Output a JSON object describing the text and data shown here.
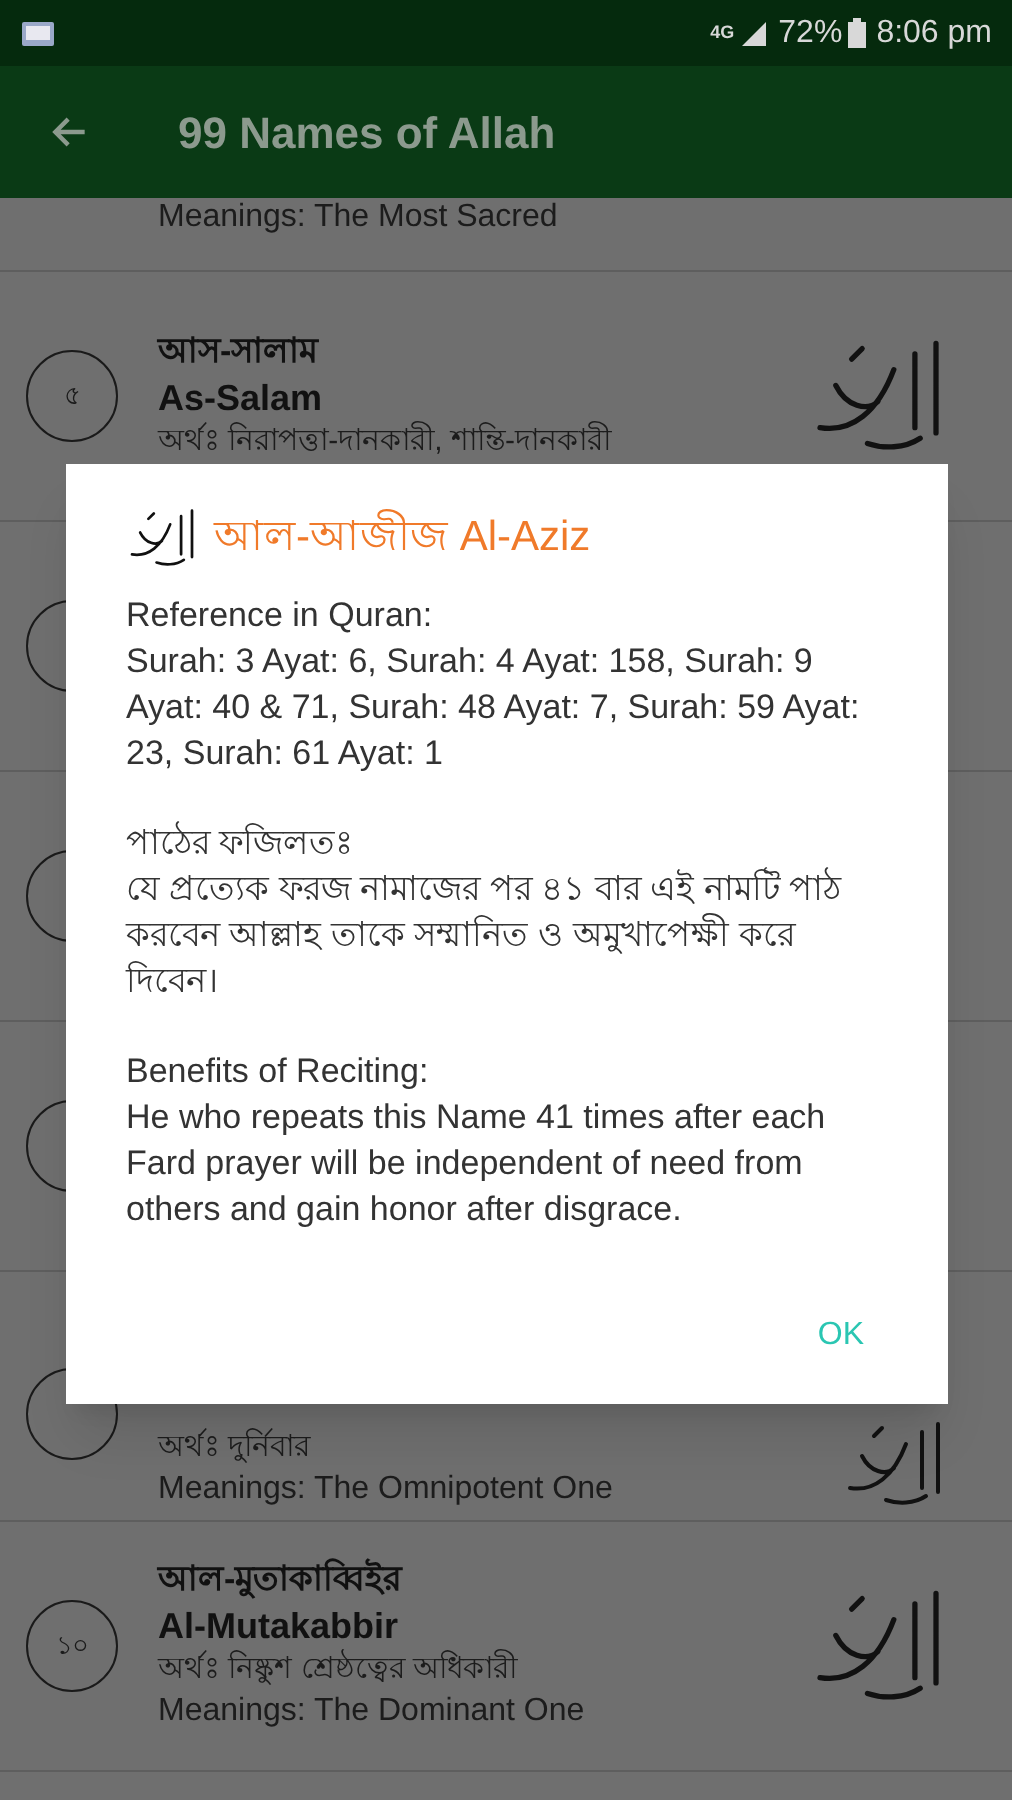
{
  "status_bar": {
    "signal_label": "4G",
    "battery": "72%",
    "time": "8:06 pm"
  },
  "app_bar": {
    "title": "99 Names of Allah"
  },
  "list": [
    {
      "kind": "partial",
      "meaning_en": "Meanings: The Most Sacred"
    },
    {
      "kind": "full",
      "number": "৫",
      "name_bn": "আস-সালাম",
      "name_en": "As-Salam",
      "meaning_bn": "অর্থঃ নিরাপত্তা-দানকারী, শান্তি-দানকারী"
    },
    {
      "kind": "hidden"
    },
    {
      "kind": "hidden"
    },
    {
      "kind": "hidden"
    },
    {
      "kind": "tail",
      "meaning_bn": "অর্থঃ দুর্নিবার",
      "meaning_en": "Meanings: The Omnipotent One"
    },
    {
      "kind": "full",
      "number": "১০",
      "name_bn": "আল-মুতাকাব্বিইর",
      "name_en": "Al-Mutakabbir",
      "meaning_bn": "অর্থঃ নিষ্কুশ শ্রেষ্ঠত্বের অধিকারী",
      "meaning_en": "Meanings: The Dominant One"
    }
  ],
  "dialog": {
    "title": "আল-আজীজ Al-Aziz",
    "paragraphs": [
      {
        "heading": "Reference in Quran:",
        "body": "Surah: 3 Ayat: 6, Surah: 4 Ayat: 158, Surah: 9 Ayat: 40 & 71, Surah: 48 Ayat: 7, Surah: 59 Ayat: 23, Surah: 61 Ayat: 1"
      },
      {
        "heading": "পাঠের ফজিলতঃ",
        "body": "যে প্রত্যেক ফরজ নামাজের পর ৪১ বার এই নামটি পাঠ করবেন আল্লাহ তাকে সম্মানিত ও অমুখাপেক্ষী করে দিবেন।"
      },
      {
        "heading": "Benefits of Reciting:",
        "body": "He who repeats this Name 41 times after each Fard prayer will be independent of need from others and gain honor after disgrace."
      }
    ],
    "button": "OK"
  }
}
